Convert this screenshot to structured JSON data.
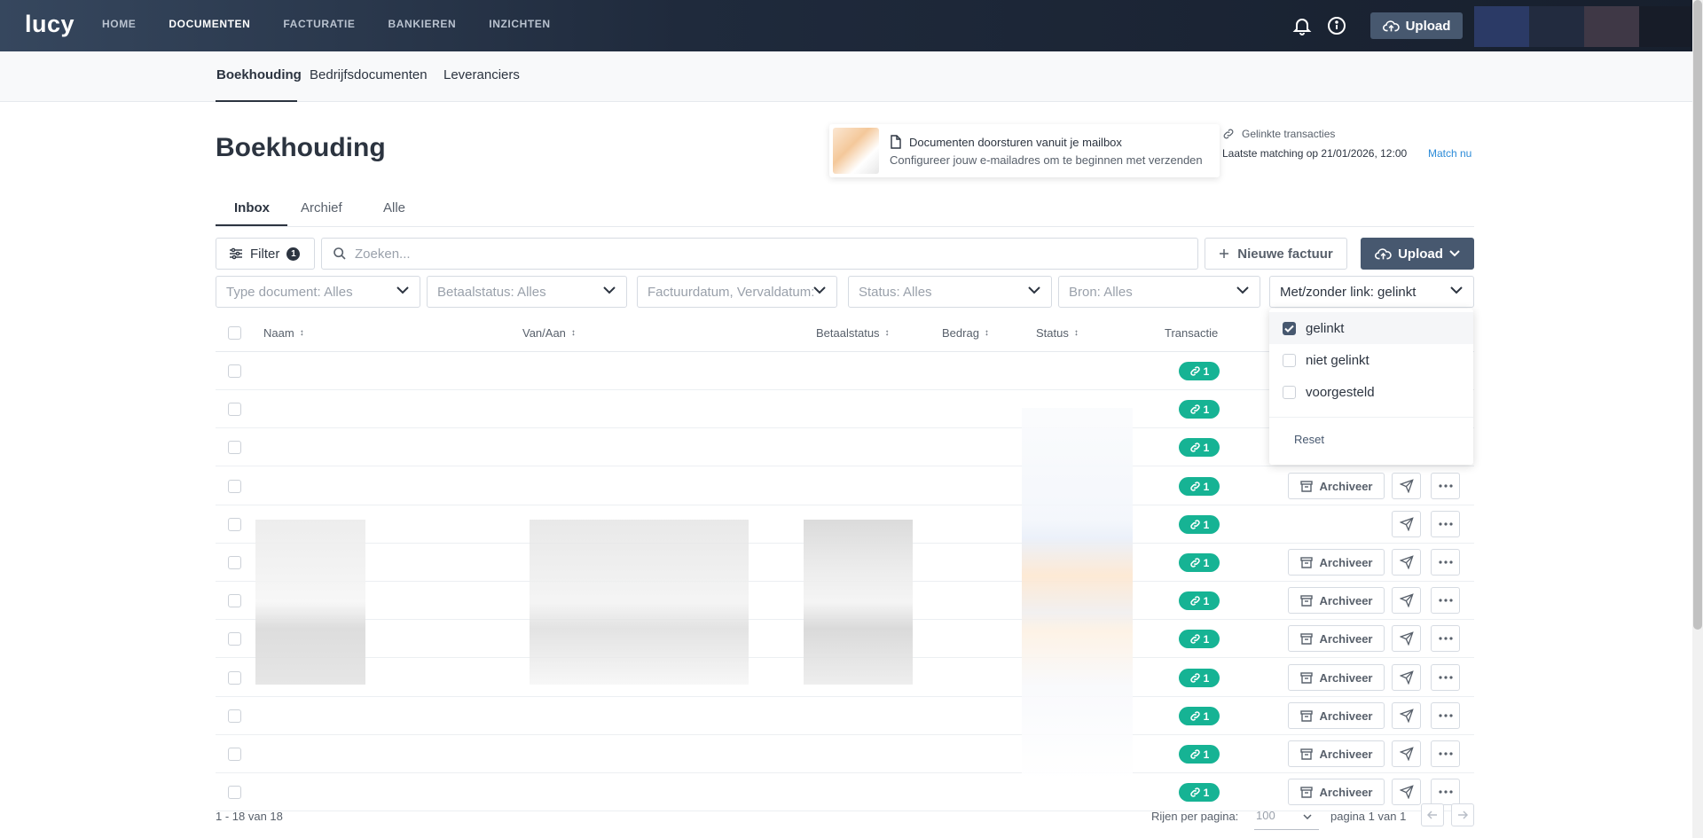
{
  "app": {
    "logo": "lucy"
  },
  "nav": {
    "items": [
      {
        "label": "HOME",
        "active": false
      },
      {
        "label": "DOCUMENTEN",
        "active": true
      },
      {
        "label": "FACTURATIE",
        "active": false
      },
      {
        "label": "BANKIEREN",
        "active": false
      },
      {
        "label": "INZICHTEN",
        "active": false
      }
    ],
    "upload_label": "Upload"
  },
  "subnav": {
    "items": [
      {
        "label": "Boekhouding",
        "active": true
      },
      {
        "label": "Bedrijfsdocumenten",
        "active": false
      },
      {
        "label": "Leveranciers",
        "active": false
      }
    ]
  },
  "page": {
    "title": "Boekhouding"
  },
  "mailbox_card": {
    "title": "Documenten doorsturen vanuit je mailbox",
    "subtitle": "Configureer jouw e-mailadres om te beginnen met verzenden"
  },
  "linked": {
    "label": "Gelinkte transacties",
    "last_matching": "Laatste matching op 21/01/2026, 12:00",
    "match_now": "Match nu"
  },
  "tabs": [
    {
      "label": "Inbox",
      "active": true
    },
    {
      "label": "Archief",
      "active": false
    },
    {
      "label": "Alle",
      "active": false
    }
  ],
  "toolbar": {
    "filter_label": "Filter",
    "filter_count": "1",
    "search_placeholder": "Zoeken...",
    "new_invoice_label": "Nieuwe factuur",
    "upload_label": "Upload"
  },
  "filters": [
    {
      "label": "Type document: Alles"
    },
    {
      "label": "Betaalstatus: Alles"
    },
    {
      "label": "Factuurdatum, Vervaldatum:"
    },
    {
      "label": "Status: Alles"
    },
    {
      "label": "Bron: Alles"
    },
    {
      "label": "Met/zonder link: gelinkt"
    }
  ],
  "table": {
    "columns": [
      "Naam",
      "Van/Aan",
      "Betaalstatus",
      "Bedrag",
      "Status",
      "Transactie"
    ],
    "link_count": "1",
    "archive_label": "Archiveer",
    "rows": [
      {
        "archive": false
      },
      {
        "archive": false
      },
      {
        "archive": false
      },
      {
        "archive": true
      },
      {
        "archive": false
      },
      {
        "archive": true
      },
      {
        "archive": true
      },
      {
        "archive": true
      },
      {
        "archive": true
      },
      {
        "archive": true
      },
      {
        "archive": true
      },
      {
        "archive": true
      }
    ]
  },
  "link_dropdown": {
    "options": [
      {
        "label": "gelinkt",
        "checked": true
      },
      {
        "label": "niet gelinkt",
        "checked": false
      },
      {
        "label": "voorgesteld",
        "checked": false
      }
    ],
    "reset_label": "Reset"
  },
  "footer": {
    "count": "1 - 18 van 18",
    "rows_per_page_label": "Rijen per pagina:",
    "rows_per_page_value": "100",
    "page_label": "pagina 1 van 1"
  },
  "colors": {
    "accent": "#47586f",
    "link_pill": "#16b394",
    "nav_bg": "#1f2a3c",
    "link_text": "#2c8bd8"
  }
}
